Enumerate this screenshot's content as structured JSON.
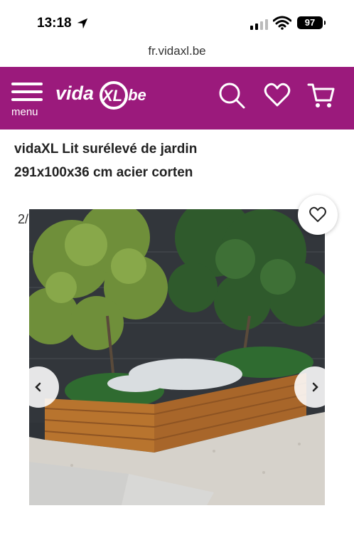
{
  "status": {
    "time": "13:18",
    "battery": "97"
  },
  "browser": {
    "url": "fr.vidaxl.be"
  },
  "header": {
    "menu_label": "menu",
    "logo": {
      "vida": "vida",
      "xl": "XL",
      "domain": ".be"
    },
    "icons": [
      "search-icon",
      "heart-icon",
      "cart-icon"
    ]
  },
  "product": {
    "title_line1": "vidaXL Lit surélevé de jardin",
    "title_line2": "291x100x36 cm acier corten",
    "image_counter": "2/",
    "image_alt": "Raised corten steel garden bed with plants"
  },
  "colors": {
    "brand": "#9b1a7c",
    "corten": "#b8742e"
  }
}
